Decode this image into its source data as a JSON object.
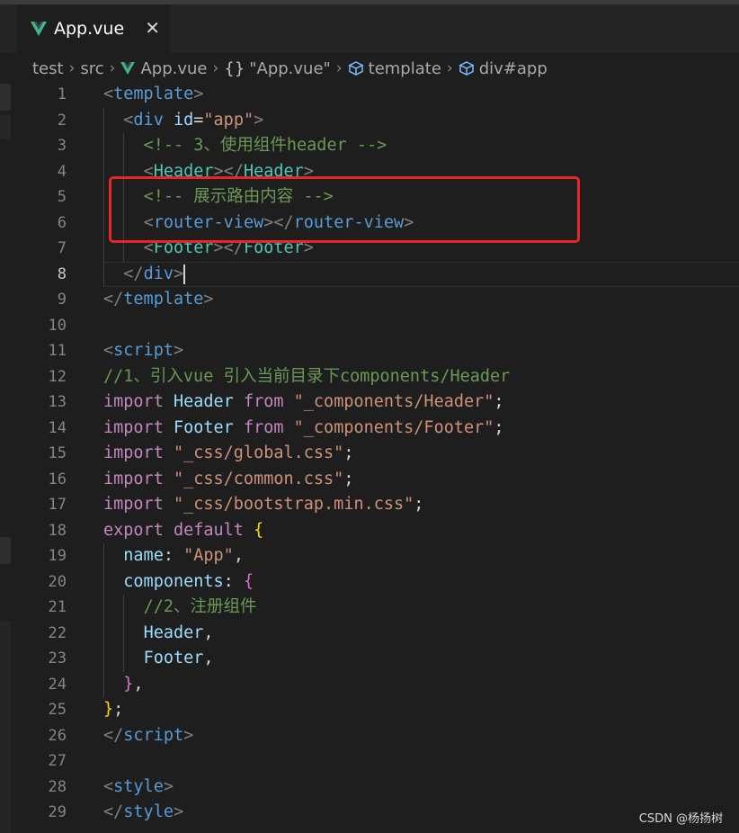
{
  "tab": {
    "title": "App.vue",
    "close_glyph": "✕",
    "icon": "vue-icon"
  },
  "breadcrumb": {
    "items": [
      "test",
      "src",
      "App.vue",
      "\"App.vue\"",
      "template",
      "div#app"
    ],
    "separator": "›",
    "braces": "{}"
  },
  "editor": {
    "active_line": 8,
    "line_numbers": [
      "1",
      "2",
      "3",
      "4",
      "5",
      "6",
      "7",
      "8",
      "9",
      "10",
      "11",
      "12",
      "13",
      "14",
      "15",
      "16",
      "17",
      "18",
      "19",
      "20",
      "21",
      "22",
      "23",
      "24",
      "25",
      "26",
      "27",
      "28",
      "29"
    ],
    "lines": [
      [
        [
          "br",
          "<"
        ],
        [
          "tag",
          "template"
        ],
        [
          "br",
          ">"
        ]
      ],
      [
        [
          "p",
          "  "
        ],
        [
          "br",
          "<"
        ],
        [
          "tag",
          "div"
        ],
        [
          "p",
          " "
        ],
        [
          "attr",
          "id"
        ],
        [
          "p",
          "="
        ],
        [
          "str",
          "\"app\""
        ],
        [
          "br",
          ">"
        ]
      ],
      [
        [
          "p",
          "    "
        ],
        [
          "com",
          "<!-- 3、使用组件header -->"
        ]
      ],
      [
        [
          "p",
          "    "
        ],
        [
          "br",
          "<"
        ],
        [
          "comp",
          "Header"
        ],
        [
          "br",
          "></"
        ],
        [
          "comp",
          "Header"
        ],
        [
          "br",
          ">"
        ]
      ],
      [
        [
          "p",
          "    "
        ],
        [
          "com",
          "<!-- 展示路由内容 -->"
        ]
      ],
      [
        [
          "p",
          "    "
        ],
        [
          "br",
          "<"
        ],
        [
          "tag",
          "router-view"
        ],
        [
          "br",
          "></"
        ],
        [
          "tag",
          "router-view"
        ],
        [
          "br",
          ">"
        ]
      ],
      [
        [
          "p",
          "    "
        ],
        [
          "br",
          "<"
        ],
        [
          "comp",
          "Footer"
        ],
        [
          "br",
          "></"
        ],
        [
          "comp",
          "Footer"
        ],
        [
          "br",
          ">"
        ]
      ],
      [
        [
          "p",
          "  "
        ],
        [
          "br",
          "</"
        ],
        [
          "tag",
          "div"
        ],
        [
          "br",
          ">"
        ]
      ],
      [
        [
          "br",
          "</"
        ],
        [
          "tag",
          "template"
        ],
        [
          "br",
          ">"
        ]
      ],
      [],
      [
        [
          "br",
          "<"
        ],
        [
          "tag",
          "script"
        ],
        [
          "br",
          ">"
        ]
      ],
      [
        [
          "com",
          "//1、引入vue 引入当前目录下components/Header"
        ]
      ],
      [
        [
          "kw",
          "import"
        ],
        [
          "p",
          " "
        ],
        [
          "id",
          "Header"
        ],
        [
          "p",
          " "
        ],
        [
          "kw",
          "from"
        ],
        [
          "p",
          " "
        ],
        [
          "str",
          "\"_components/Header\""
        ],
        [
          "p",
          ";"
        ]
      ],
      [
        [
          "kw",
          "import"
        ],
        [
          "p",
          " "
        ],
        [
          "id",
          "Footer"
        ],
        [
          "p",
          " "
        ],
        [
          "kw",
          "from"
        ],
        [
          "p",
          " "
        ],
        [
          "str",
          "\"_components/Footer\""
        ],
        [
          "p",
          ";"
        ]
      ],
      [
        [
          "kw",
          "import"
        ],
        [
          "p",
          " "
        ],
        [
          "str",
          "\"_css/global.css\""
        ],
        [
          "p",
          ";"
        ]
      ],
      [
        [
          "kw",
          "import"
        ],
        [
          "p",
          " "
        ],
        [
          "str",
          "\"_css/common.css\""
        ],
        [
          "p",
          ";"
        ]
      ],
      [
        [
          "kw",
          "import"
        ],
        [
          "p",
          " "
        ],
        [
          "str",
          "\"_css/bootstrap.min.css\""
        ],
        [
          "p",
          ";"
        ]
      ],
      [
        [
          "kw",
          "export"
        ],
        [
          "p",
          " "
        ],
        [
          "kw",
          "default"
        ],
        [
          "p",
          " "
        ],
        [
          "b1",
          "{"
        ]
      ],
      [
        [
          "p",
          "  "
        ],
        [
          "id",
          "name"
        ],
        [
          "p",
          ": "
        ],
        [
          "str",
          "\"App\""
        ],
        [
          "p",
          ","
        ]
      ],
      [
        [
          "p",
          "  "
        ],
        [
          "id",
          "components"
        ],
        [
          "p",
          ": "
        ],
        [
          "b2",
          "{"
        ]
      ],
      [
        [
          "p",
          "    "
        ],
        [
          "com",
          "//2、注册组件"
        ]
      ],
      [
        [
          "p",
          "    "
        ],
        [
          "id",
          "Header"
        ],
        [
          "p",
          ","
        ]
      ],
      [
        [
          "p",
          "    "
        ],
        [
          "id",
          "Footer"
        ],
        [
          "p",
          ","
        ]
      ],
      [
        [
          "p",
          "  "
        ],
        [
          "b2",
          "}"
        ],
        [
          "p",
          ","
        ]
      ],
      [
        [
          "b1",
          "}"
        ],
        [
          "p",
          ";"
        ]
      ],
      [
        [
          "br",
          "</"
        ],
        [
          "tag",
          "script"
        ],
        [
          "br",
          ">"
        ]
      ],
      [],
      [
        [
          "br",
          "<"
        ],
        [
          "tag",
          "style"
        ],
        [
          "br",
          ">"
        ]
      ],
      [
        [
          "br",
          "</"
        ],
        [
          "tag",
          "style"
        ],
        [
          "br",
          ">"
        ]
      ]
    ]
  },
  "highlight": {
    "color": "#e8252a",
    "from_line": 5,
    "to_line": 6
  },
  "colors": {
    "background": "#1e1e1e",
    "tag": "#569cd6",
    "string": "#ce9178",
    "comment": "#6a9955",
    "keyword": "#c586c0",
    "identifier": "#9cdcfe",
    "vue_green": "#41b883"
  },
  "watermark": "CSDN @杨扬树"
}
